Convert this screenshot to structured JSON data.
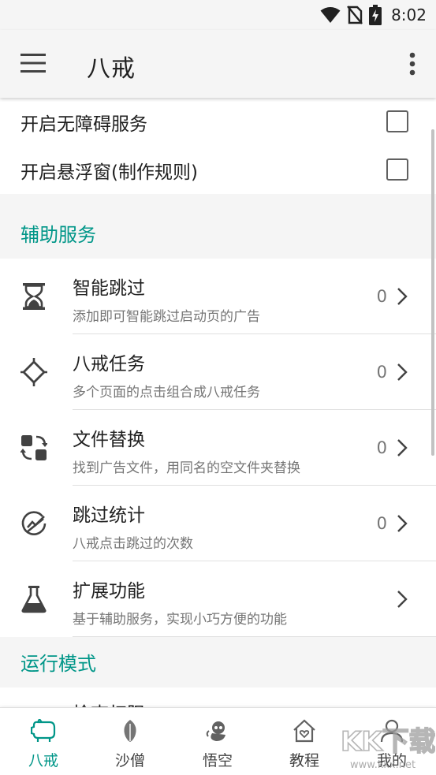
{
  "status_bar": {
    "time": "8:02"
  },
  "app_bar": {
    "title": "八戒"
  },
  "toggles": [
    {
      "label": "开启无障碍服务",
      "checked": false
    },
    {
      "label": "开启悬浮窗(制作规则)",
      "checked": false
    }
  ],
  "sections": {
    "assist": "辅助服务",
    "run_mode": "运行模式"
  },
  "list_items": [
    {
      "title": "智能跳过",
      "subtitle": "添加即可智能跳过启动页的广告",
      "count": "0",
      "icon": "hourglass-icon"
    },
    {
      "title": "八戒任务",
      "subtitle": "多个页面的点击组合成八戒任务",
      "count": "0",
      "icon": "task-flow-icon"
    },
    {
      "title": "文件替换",
      "subtitle": "找到广告文件，用同名的空文件夹替换",
      "count": "0",
      "icon": "file-swap-icon"
    },
    {
      "title": "跳过统计",
      "subtitle": "八戒点击跳过的次数",
      "count": "0",
      "icon": "stats-check-icon"
    },
    {
      "title": "扩展功能",
      "subtitle": "基于辅助服务，实现小巧方便的功能",
      "count": "",
      "icon": "flask-icon"
    }
  ],
  "partial_item": {
    "title": "检查权限"
  },
  "bottom_nav": [
    {
      "label": "八戒",
      "icon": "pig-icon",
      "active": true
    },
    {
      "label": "沙僧",
      "icon": "leaf-icon",
      "active": false
    },
    {
      "label": "悟空",
      "icon": "monkey-icon",
      "active": false
    },
    {
      "label": "教程",
      "icon": "home-heart-icon",
      "active": false
    },
    {
      "label": "我的",
      "icon": "person-icon",
      "active": false
    }
  ],
  "watermark": {
    "text": "KK下载",
    "url": "www.kkx.net"
  },
  "colors": {
    "accent": "#009688",
    "background": "#f5f5f5",
    "card": "#ffffff",
    "text": "#212121",
    "secondary_text": "#757575"
  }
}
